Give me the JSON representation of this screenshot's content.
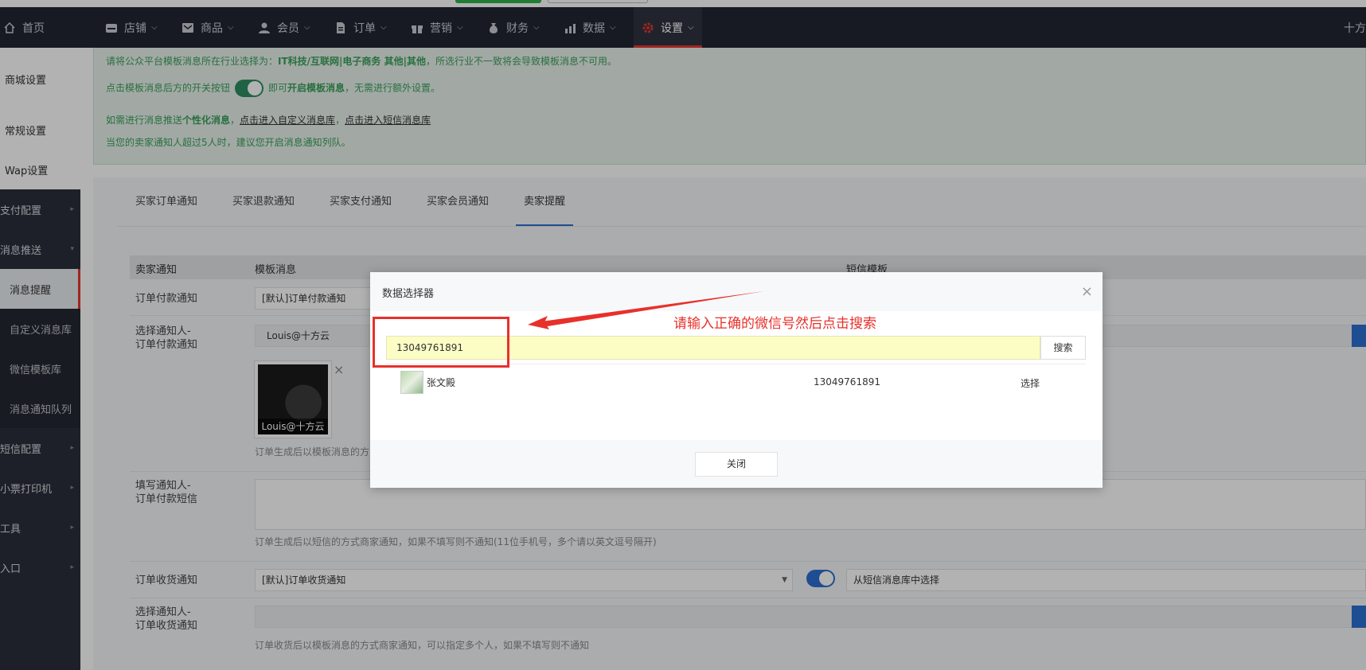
{
  "topnav": {
    "items": [
      {
        "label": "首页",
        "icon": "home-icon"
      },
      {
        "label": "店铺",
        "icon": "store-icon"
      },
      {
        "label": "商品",
        "icon": "goods-icon"
      },
      {
        "label": "会员",
        "icon": "member-icon"
      },
      {
        "label": "订单",
        "icon": "order-icon"
      },
      {
        "label": "营销",
        "icon": "gift-icon"
      },
      {
        "label": "财务",
        "icon": "money-bag-icon"
      },
      {
        "label": "数据",
        "icon": "bar-chart-icon"
      },
      {
        "label": "设置",
        "icon": "gear-icon",
        "active": true
      }
    ],
    "brand_tail": "十方"
  },
  "sidebar": {
    "items": [
      {
        "label": "商城设置"
      },
      {
        "label": "常规设置"
      },
      {
        "label": "Wap设置"
      },
      {
        "label": "支付配置"
      },
      {
        "label": "消息推送"
      },
      {
        "label": "消息提醒"
      },
      {
        "label": "自定义消息库"
      },
      {
        "label": "微信模板库"
      },
      {
        "label": "消息通知队列"
      },
      {
        "label": "短信配置"
      },
      {
        "label": "小票打印机"
      },
      {
        "label": "工具"
      },
      {
        "label": "入口"
      }
    ]
  },
  "notice": {
    "line1_prefix": "请将公众平台模板消息所在行业选择为：",
    "line1_bold": "IT科技/互联网|电子商务 其他|其他",
    "line1_suffix": "，所选行业不一致将会导致模板消息不可用。",
    "line2_prefix": "点击模板消息后方的开关按钮",
    "line2_mid": "即可",
    "line2_bold": "开启模板消息",
    "line2_suffix": "，无需进行额外设置。",
    "line3_prefix": "如需进行消息推送",
    "line3_bold": "个性化消息",
    "line3_sep": "，",
    "line3_link1": "点击进入自定义消息库",
    "line3_sep2": "，",
    "line3_link2": "点击进入短信消息库",
    "line4": "当您的卖家通知人超过5人时，建议您开启消息通知列队。"
  },
  "tabs": [
    "买家订单通知",
    "买家退款通知",
    "买家支付通知",
    "买家会员通知",
    "卖家提醒"
  ],
  "table": {
    "headers": [
      "卖家通知",
      "模板消息",
      "短信模板"
    ],
    "rows": {
      "order_pay_label": "订单付款通知",
      "order_pay_value": "[默认]订单付款通知",
      "choose_notifier_label1": "选择通知人-",
      "choose_notifier_label2": "订单付款通知",
      "notifier_value": "Louis@十方云",
      "avatar_caption": "Louis@十方云",
      "avatar_help": "订单生成后以模板消息的方",
      "sms_notifier_label1": "填写通知人-",
      "sms_notifier_label2": "订单付款短信",
      "sms_help": "订单生成后以短信的方式商家通知，如果不填写则不通知(11位手机号，多个请以英文逗号隔开)",
      "receive_label": "订单收货通知",
      "receive_value": "[默认]订单收货通知",
      "receive_sms_value": "从短信消息库中选择",
      "choose_receive_label1": "选择通知人-",
      "choose_receive_label2": "订单收货通知",
      "receive_help": "订单收货后以模板消息的方式商家通知，可以指定多个人，如果不填写则不通知"
    }
  },
  "dialog": {
    "title": "数据选择器",
    "close_glyph": "×",
    "search_value": "13049761891",
    "search_button": "搜索",
    "result": {
      "name": "张文殿",
      "phone": "13049761891",
      "action": "选择"
    },
    "footer_button": "关闭"
  },
  "annotation": {
    "text": "请输入正确的微信号然后点击搜索",
    "color": "#e8302b"
  }
}
